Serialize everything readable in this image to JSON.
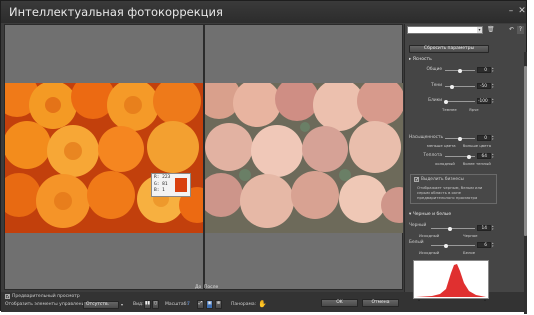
{
  "window": {
    "title": "Интеллектуальная фотокоррекция",
    "min_glyph": "–",
    "close_glyph": "✕"
  },
  "preview": {
    "before_label": "До",
    "after_label": "После",
    "readout": {
      "r": "R: 223",
      "g": "G: 81",
      "b": "B: 1",
      "swatch_color": "#d9400f"
    }
  },
  "bottom": {
    "preview_checkbox": "Предварительный просмотр",
    "show_controls": "Отобразить элементы управления:",
    "show_controls_value": "Отсутств.",
    "view_label": "Вид:",
    "zoom_label": "Масштаб:",
    "zoom_value": "7",
    "pan_label": "Панорама:",
    "ok": "OK",
    "cancel": "Отмена"
  },
  "sidebar": {
    "preset_value": "",
    "reset_button": "Сбросить параметры",
    "clarity": {
      "title": "Ясность",
      "overall": {
        "label": "Общие",
        "value": "0"
      },
      "shadows": {
        "label": "Тени",
        "value": "-50"
      },
      "highlights": {
        "label": "Блики",
        "value": "-100"
      },
      "sub_left": "Темнее",
      "sub_right": "Ярче"
    },
    "saturation": {
      "label": "Насыщенность",
      "value": "0",
      "sub_left": "меньше цвета",
      "sub_right": "больше цвета"
    },
    "warmth": {
      "label": "Теплота",
      "value": "64",
      "sub_left": "холодный",
      "sub_right": "более теплый"
    },
    "highlight_clip": {
      "label": "Выделить бизнесы",
      "checked": true,
      "info": "Отображает черным, белым или серым область в окне предварительного просмотра"
    },
    "black_white": {
      "title": "Черные и белые",
      "black": {
        "label": "Черный",
        "value": "14",
        "sub_left": "Исходный",
        "sub_right": "Черное"
      },
      "white": {
        "label": "Белый",
        "value": "6",
        "sub_left": "Исходный",
        "sub_right": "Белое"
      }
    },
    "histogram_color": "#e03030"
  }
}
